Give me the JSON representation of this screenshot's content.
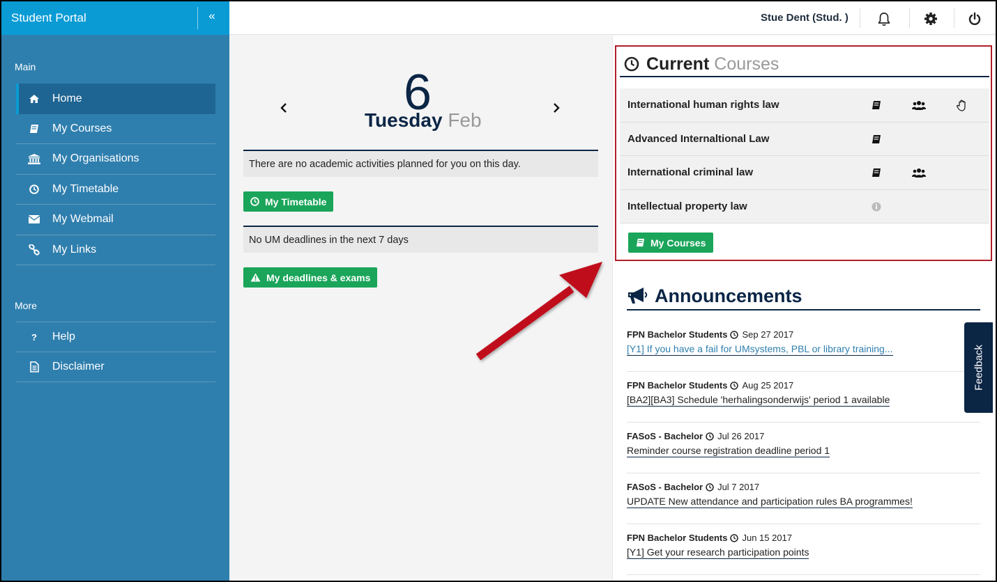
{
  "sidebar": {
    "brand": "Student Portal",
    "collapse_glyph": "«",
    "main_label": "Main",
    "main_items": [
      {
        "label": "Home",
        "icon": "home-icon"
      },
      {
        "label": "My Courses",
        "icon": "book-icon"
      },
      {
        "label": "My Organisations",
        "icon": "institution-icon"
      },
      {
        "label": "My Timetable",
        "icon": "clock-icon"
      },
      {
        "label": "My Webmail",
        "icon": "envelope-icon"
      },
      {
        "label": "My Links",
        "icon": "link-icon"
      }
    ],
    "more_label": "More",
    "more_items": [
      {
        "label": "Help",
        "icon": "question-icon"
      },
      {
        "label": "Disclaimer",
        "icon": "document-icon"
      }
    ]
  },
  "topbar": {
    "user_name": "Stue Dent (Stud. )",
    "icons": [
      "bell-icon",
      "gear-icon",
      "power-icon"
    ]
  },
  "calendar": {
    "day_number": "6",
    "day_name": "Tuesday",
    "month": "Feb",
    "no_activities": "There are no academic activities planned for you on this day.",
    "timetable_button": "My Timetable",
    "no_deadlines": "No UM deadlines in the next 7 days",
    "deadlines_button": "My deadlines & exams"
  },
  "current_courses": {
    "title_bold": "Current",
    "title_light": "Courses",
    "courses": [
      {
        "name": "International human rights law",
        "icons": [
          "book-icon",
          "users-icon",
          "hand-icon"
        ]
      },
      {
        "name": "Advanced Internaltional Law",
        "icons": [
          "book-icon"
        ]
      },
      {
        "name": "International criminal law",
        "icons": [
          "book-icon",
          "users-icon"
        ]
      },
      {
        "name": "Intellectual property law",
        "icons": [
          "info-icon"
        ]
      }
    ],
    "button": "My Courses"
  },
  "announcements": {
    "title": "Announcements",
    "items": [
      {
        "author": "FPN Bachelor Students",
        "date": "Sep 27 2017",
        "link": "[Y1] If you have a fail for UMsystems, PBL or library training..."
      },
      {
        "author": "FPN Bachelor Students",
        "date": "Aug 25 2017",
        "link": "[BA2][BA3] Schedule 'herhalingsonderwijs' period 1 available"
      },
      {
        "author": "FASoS - Bachelor",
        "date": "Jul 26 2017",
        "link": "Reminder course registration deadline period 1"
      },
      {
        "author": "FASoS - Bachelor",
        "date": "Jul 7 2017",
        "link": "UPDATE New attendance and participation rules BA programmes!"
      },
      {
        "author": "FPN Bachelor Students",
        "date": "Jun 15 2017",
        "link": "[Y1] Get your research participation points"
      }
    ]
  },
  "feedback": {
    "label": "Feedback"
  },
  "colors": {
    "sidebar": "#2f7fae",
    "sidebar_header": "#0a9bd5",
    "navy": "#0b2545",
    "green": "#1aa55a",
    "highlight_red": "#b01e2a",
    "arrow_red": "#c0101a"
  }
}
